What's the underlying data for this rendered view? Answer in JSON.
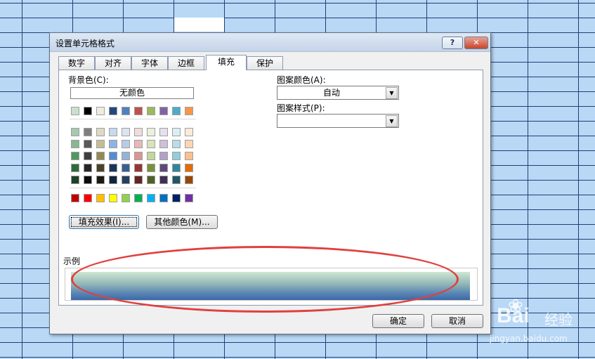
{
  "dialog": {
    "title": "设置单元格格式",
    "help_label": "?",
    "close_label": "✕",
    "tabs": [
      "数字",
      "对齐",
      "字体",
      "边框",
      "填充",
      "保护"
    ],
    "active_tab": "填充"
  },
  "fill": {
    "background_label": "背景色(C):",
    "no_color_label": "无颜色",
    "palette_top": [
      "#c7e1cd",
      "#000000",
      "#eeece1",
      "#1f497d",
      "#4f81bd",
      "#c0504d",
      "#9bbb59",
      "#8064a2",
      "#4bacc6",
      "#f79646"
    ],
    "palette_theme": [
      [
        "#a6c8ad",
        "#7f7f7f",
        "#ddd9c3",
        "#c6d9f0",
        "#dbe5f1",
        "#f2dcdb",
        "#ebf1dd",
        "#e5e0ec",
        "#dbeef3",
        "#fdeada"
      ],
      [
        "#86b894",
        "#595959",
        "#c4bd97",
        "#8db3e2",
        "#b8cce4",
        "#e5b9b7",
        "#d7e3bc",
        "#ccc1d9",
        "#b7dde8",
        "#fbd5b5"
      ],
      [
        "#4e9a5e",
        "#3f3f3f",
        "#938953",
        "#548dd4",
        "#95b3d7",
        "#d99694",
        "#c3d69b",
        "#b2a2c7",
        "#92cddc",
        "#fac08f"
      ],
      [
        "#2e6b3b",
        "#262626",
        "#494429",
        "#17365d",
        "#366092",
        "#953734",
        "#76923c",
        "#5f497a",
        "#31859b",
        "#e36c09"
      ],
      [
        "#1c4325",
        "#0c0c0c",
        "#1d1b10",
        "#0f243e",
        "#244061",
        "#632423",
        "#4f6128",
        "#3f3151",
        "#205867",
        "#974806"
      ]
    ],
    "palette_standard": [
      "#c00000",
      "#ff0000",
      "#ffc000",
      "#ffff00",
      "#92d050",
      "#00b050",
      "#00b0f0",
      "#0070c0",
      "#002060",
      "#7030a0"
    ],
    "fill_effects_label": "填充效果(I)...",
    "more_colors_label": "其他颜色(M)...",
    "pattern_color_label": "图案颜色(A):",
    "pattern_color_value": "自动",
    "pattern_style_label": "图案样式(P):",
    "pattern_style_value": "",
    "sample_label": "示例"
  },
  "buttons": {
    "ok": "确定",
    "cancel": "取消"
  },
  "watermark": {
    "logo": "Bai",
    "jingyan": "经验",
    "url": "jingyan.baidu.com"
  }
}
